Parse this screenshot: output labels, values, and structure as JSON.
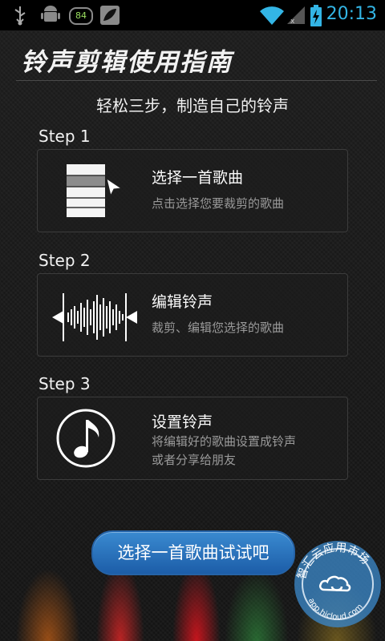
{
  "status_bar": {
    "time": "20:13",
    "battery_badge": "84",
    "icons": [
      "usb-icon",
      "android-debug-icon",
      "battery-badge-icon",
      "leaf-icon",
      "wifi-icon",
      "signal-icon",
      "battery-icon"
    ],
    "time_color": "#33b5e5"
  },
  "header": {
    "title": "铃声剪辑使用指南",
    "subtitle": "轻松三步，制造自己的铃声"
  },
  "steps": [
    {
      "label": "Step 1",
      "title": "选择一首歌曲",
      "desc": "点击选择您要裁剪的歌曲",
      "icon": "song-list-icon"
    },
    {
      "label": "Step 2",
      "title": "编辑铃声",
      "desc": "裁剪、编辑您选择的歌曲",
      "icon": "waveform-icon"
    },
    {
      "label": "Step 3",
      "title": "设置铃声",
      "desc_line1": "将编辑好的歌曲设置成铃声",
      "desc_line2": "或者分享给朋友",
      "icon": "music-note-icon"
    }
  ],
  "action": {
    "label": "选择一首歌曲试试吧",
    "color": "#2a74c0"
  },
  "watermark": {
    "text": "智汇云应用市场",
    "url": "app.hicloud.com"
  }
}
